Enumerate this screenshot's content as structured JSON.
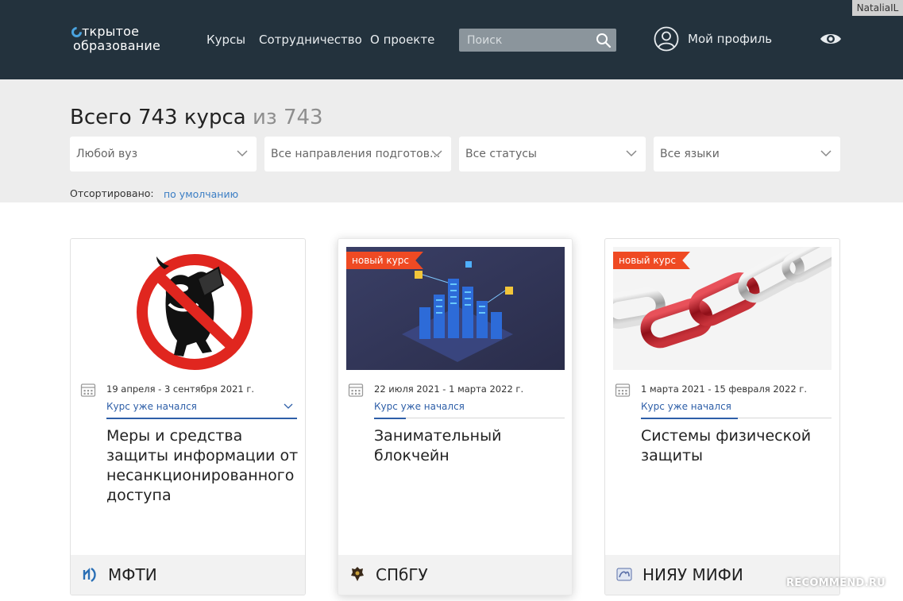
{
  "header": {
    "logo_line1": "ткрытое",
    "logo_line2": "образование",
    "nav": [
      "Курсы",
      "Сотрудничество",
      "О проекте"
    ],
    "search_placeholder": "Поиск",
    "profile_label": "Мой профиль",
    "username_overlay": "NataliaIL"
  },
  "catalog": {
    "total_main": "Всего 743 курса",
    "total_of": "из 743",
    "filters": [
      "Любой вуз",
      "Все направления подготов...",
      "Все статусы",
      "Все языки"
    ],
    "sort_label": "Отсортировано:",
    "sort_value": "по умолчанию"
  },
  "cards": [
    {
      "badge": "",
      "dates": "19 апреля - 3 сентября 2021 г.",
      "status": "Курс уже начался",
      "title": "Меры и средства защиты информации от несанкционированного доступа",
      "university": "МФТИ"
    },
    {
      "badge": "новый курс",
      "dates": "22 июля 2021 - 1 марта 2022 г.",
      "status": "Курс уже начался",
      "title": "Занимательный блокчейн",
      "university": "СПбГУ"
    },
    {
      "badge": "новый курс",
      "dates": "1 марта 2021 - 15 февраля 2022 г.",
      "status": "Курс уже начался",
      "title": "Системы физической защиты",
      "university": "НИЯУ МИФИ"
    }
  ],
  "watermark": "RECOMMEND.RU",
  "colors": {
    "header_bg": "#23323d",
    "accent_blue": "#2e5fa8",
    "badge_orange": "#ef4a23",
    "filter_bg": "#ededed"
  },
  "icons": [
    "search-icon",
    "profile-icon",
    "eye-icon",
    "chevron-down-icon",
    "calendar-icon"
  ]
}
